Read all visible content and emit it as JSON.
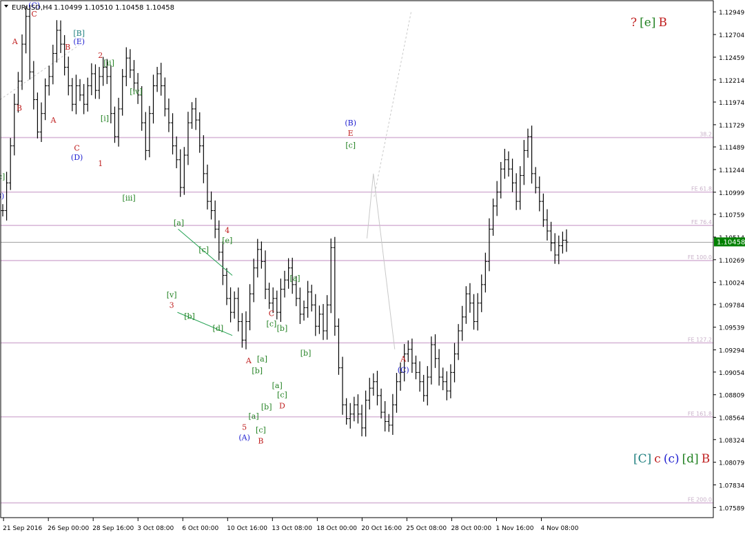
{
  "chart_data": {
    "type": "ohlc",
    "header": {
      "symbol_timeframe": "EURUSD,H4",
      "ohlc_values": "1.10499 1.10510 1.10458 1.10458"
    },
    "price_axis": {
      "ylim": [
        1.0748,
        1.1307
      ],
      "tick_labels": [
        "1.12949",
        "1.12704",
        "1.12459",
        "1.12214",
        "1.11974",
        "1.11729",
        "1.11489",
        "1.11244",
        "1.10999",
        "1.10759",
        "1.10514",
        "1.10269",
        "1.10024",
        "1.09784",
        "1.09539",
        "1.09294",
        "1.09054",
        "1.08809",
        "1.08564",
        "1.08324",
        "1.08079",
        "1.07834",
        "1.07589"
      ],
      "current_price": "1.10458",
      "current_price_color": "#008000"
    },
    "time_axis": {
      "tick_labels": [
        "21 Sep 2016",
        "26 Sep 00:00",
        "28 Sep 16:00",
        "3 Oct 08:00",
        "6 Oct 00:00",
        "10 Oct 16:00",
        "13 Oct 08:00",
        "18 Oct 00:00",
        "20 Oct 16:00",
        "25 Oct 08:00",
        "28 Oct 00:00",
        "1 Nov 16:00",
        "4 Nov 08:00"
      ]
    },
    "levels": [
      {
        "label": "38.2",
        "value": 1.1159
      },
      {
        "label": "FE 61.8",
        "value": 1.11
      },
      {
        "label": "FE 76.4",
        "value": 1.1064
      },
      {
        "label": "FE 100.0",
        "value": 1.1026
      },
      {
        "label": "FE 127.2",
        "value": 1.0937
      },
      {
        "label": "FE 161.8",
        "value": 1.0857
      },
      {
        "label": "FE 200.0",
        "value": 1.0764
      }
    ],
    "price_path": [
      1.108,
      1.111,
      1.115,
      1.1195,
      1.122,
      1.126,
      1.129,
      1.123,
      1.12,
      1.1165,
      1.1185,
      1.1215,
      1.1225,
      1.125,
      1.1275,
      1.126,
      1.1235,
      1.1215,
      1.1195,
      1.1215,
      1.1205,
      1.1195,
      1.1215,
      1.1228,
      1.121,
      1.1225,
      1.1235,
      1.1225,
      1.1185,
      1.116,
      1.119,
      1.1225,
      1.1245,
      1.1232,
      1.1218,
      1.1205,
      1.1175,
      1.1145,
      1.1185,
      1.1215,
      1.1228,
      1.1215,
      1.119,
      1.1175,
      1.115,
      1.1135,
      1.1105,
      1.114,
      1.1175,
      1.119,
      1.1178,
      1.115,
      1.112,
      1.109,
      1.108,
      1.106,
      1.1035,
      1.101,
      1.0985,
      1.097,
      1.0985,
      1.096,
      1.094,
      1.096,
      1.099,
      1.1018,
      1.1038,
      1.1025,
      1.0995,
      1.098,
      1.0985,
      1.097,
      1.0995,
      1.1005,
      1.1018,
      1.1,
      1.0985,
      1.0968,
      1.0975,
      1.0992,
      1.0978,
      1.0955,
      1.0968,
      1.095,
      1.0978,
      1.104,
      1.0955,
      1.091,
      1.087,
      1.0855,
      1.086,
      1.087,
      1.086,
      1.0845,
      1.0875,
      1.0888,
      1.0895,
      1.088,
      1.0862,
      1.0852,
      1.0848,
      1.087,
      1.0895,
      1.0905,
      1.0925,
      1.093,
      1.0915,
      1.0905,
      1.0895,
      1.088,
      1.09,
      1.0935,
      1.092,
      1.09,
      1.0895,
      1.0885,
      1.0905,
      1.0925,
      1.095,
      1.0965,
      1.099,
      1.098,
      1.096,
      1.098,
      1.1,
      1.1025,
      1.106,
      1.1085,
      1.11,
      1.1125,
      1.1135,
      1.1125,
      1.111,
      1.109,
      1.1118,
      1.1145,
      1.116,
      1.112,
      1.1105,
      1.109,
      1.107,
      1.1058,
      1.1045,
      1.1032,
      1.1042,
      1.1048,
      1.1046
    ],
    "waves": [
      {
        "text": "(C)",
        "color": "#2020d0",
        "t": 0.047,
        "p": 1.1299
      },
      {
        "text": "C",
        "color": "#c02020",
        "t": 0.047,
        "p": 1.129
      },
      {
        "text": "A",
        "color": "#c02020",
        "t": 0.02,
        "p": 1.126
      },
      {
        "text": "B",
        "color": "#c02020",
        "t": 0.026,
        "p": 1.1188
      },
      {
        "text": "A",
        "color": "#c02020",
        "t": 0.074,
        "p": 1.1175
      },
      {
        "text": "B",
        "color": "#c02020",
        "t": 0.094,
        "p": 1.1254
      },
      {
        "text": "[B]",
        "color": "#208080",
        "t": 0.11,
        "p": 1.1269
      },
      {
        "text": "(E)",
        "color": "#2020d0",
        "t": 0.11,
        "p": 1.126
      },
      {
        "text": "C",
        "color": "#c02020",
        "t": 0.107,
        "p": 1.1145
      },
      {
        "text": "(D)",
        "color": "#2020d0",
        "t": 0.107,
        "p": 1.1135
      },
      {
        "text": "2",
        "color": "#c02020",
        "t": 0.14,
        "p": 1.1245
      },
      {
        "text": "[ii]",
        "color": "#208020",
        "t": 0.152,
        "p": 1.1237
      },
      {
        "text": "[i]",
        "color": "#208020",
        "t": 0.146,
        "p": 1.1177
      },
      {
        "text": "1",
        "color": "#c02020",
        "t": 0.14,
        "p": 1.1128
      },
      {
        "text": "[iv]",
        "color": "#208020",
        "t": 0.19,
        "p": 1.1206
      },
      {
        "text": "[iii]",
        "color": "#208020",
        "t": 0.18,
        "p": 1.1091
      },
      {
        "text": "[a]",
        "color": "#208020",
        "t": 0.25,
        "p": 1.1064
      },
      {
        "text": "[c]",
        "color": "#208020",
        "t": 0.285,
        "p": 1.1035
      },
      {
        "text": "[v]",
        "color": "#208020",
        "t": 0.24,
        "p": 1.0986
      },
      {
        "text": "3",
        "color": "#c02020",
        "t": 0.24,
        "p": 1.0975
      },
      {
        "text": "[b]",
        "color": "#208020",
        "t": 0.265,
        "p": 1.0963
      },
      {
        "text": "4",
        "color": "#c02020",
        "t": 0.318,
        "p": 1.1056
      },
      {
        "text": "[e]",
        "color": "#208020",
        "t": 0.318,
        "p": 1.1045
      },
      {
        "text": "[d]",
        "color": "#208020",
        "t": 0.305,
        "p": 1.095
      },
      {
        "text": "5",
        "color": "#c02020",
        "t": 0.342,
        "p": 1.0843
      },
      {
        "text": "(A)",
        "color": "#2020d0",
        "t": 0.342,
        "p": 1.0832
      },
      {
        "text": "A",
        "color": "#c02020",
        "t": 0.348,
        "p": 1.0915
      },
      {
        "text": "[a]",
        "color": "#208020",
        "t": 0.367,
        "p": 1.0917
      },
      {
        "text": "[b]",
        "color": "#208020",
        "t": 0.36,
        "p": 1.0904
      },
      {
        "text": "[a]",
        "color": "#208020",
        "t": 0.355,
        "p": 1.0855
      },
      {
        "text": "[b]",
        "color": "#208020",
        "t": 0.373,
        "p": 1.0865
      },
      {
        "text": "[c]",
        "color": "#208020",
        "t": 0.365,
        "p": 1.084
      },
      {
        "text": "B",
        "color": "#c02020",
        "t": 0.365,
        "p": 1.0828
      },
      {
        "text": "C",
        "color": "#c02020",
        "t": 0.38,
        "p": 1.0966
      },
      {
        "text": "[c]",
        "color": "#208020",
        "t": 0.38,
        "p": 1.0955
      },
      {
        "text": "[b]",
        "color": "#208020",
        "t": 0.395,
        "p": 1.095
      },
      {
        "text": "[a]",
        "color": "#208020",
        "t": 0.388,
        "p": 1.0888
      },
      {
        "text": "[c]",
        "color": "#208020",
        "t": 0.395,
        "p": 1.0878
      },
      {
        "text": "D",
        "color": "#c02020",
        "t": 0.395,
        "p": 1.0866
      },
      {
        "text": "[a]",
        "color": "#208020",
        "t": 0.413,
        "p": 1.1004
      },
      {
        "text": "[b]",
        "color": "#208020",
        "t": 0.428,
        "p": 1.0923
      },
      {
        "text": "(B)",
        "color": "#2020d0",
        "t": 0.491,
        "p": 1.1172
      },
      {
        "text": "E",
        "color": "#c02020",
        "t": 0.491,
        "p": 1.1161
      },
      {
        "text": "[c]",
        "color": "#208020",
        "t": 0.491,
        "p": 1.1148
      },
      {
        "text": "A",
        "color": "#c02020",
        "t": 0.565,
        "p": 1.0917
      },
      {
        "text": "(C)",
        "color": "#2020d0",
        "t": 0.565,
        "p": 1.0905
      },
      {
        "text": "[c]",
        "color": "#208020",
        "t": -0.001,
        "p": 1.1114
      },
      {
        "text": "B)",
        "color": "#2020d0",
        "t": -0.001,
        "p": 1.1093
      }
    ],
    "top_right_label": [
      {
        "text": "?",
        "color": "#c02020"
      },
      {
        "text": "[e]",
        "color": "#208020"
      },
      {
        "text": "B",
        "color": "#c02020"
      }
    ],
    "bottom_right_label": [
      {
        "text": "[C]",
        "color": "#208080"
      },
      {
        "text": "c",
        "color": "#c02020"
      },
      {
        "text": "(c)",
        "color": "#2020d0"
      },
      {
        "text": "[d]",
        "color": "#208020"
      },
      {
        "text": "B",
        "color": "#c02020"
      }
    ],
    "colors": {
      "level_line": "#d8b8d8",
      "level_label": "#c8b0c8",
      "triangle_line": "#20a050",
      "forecast_line": "#c8c8c8",
      "bars": "#000000"
    }
  }
}
